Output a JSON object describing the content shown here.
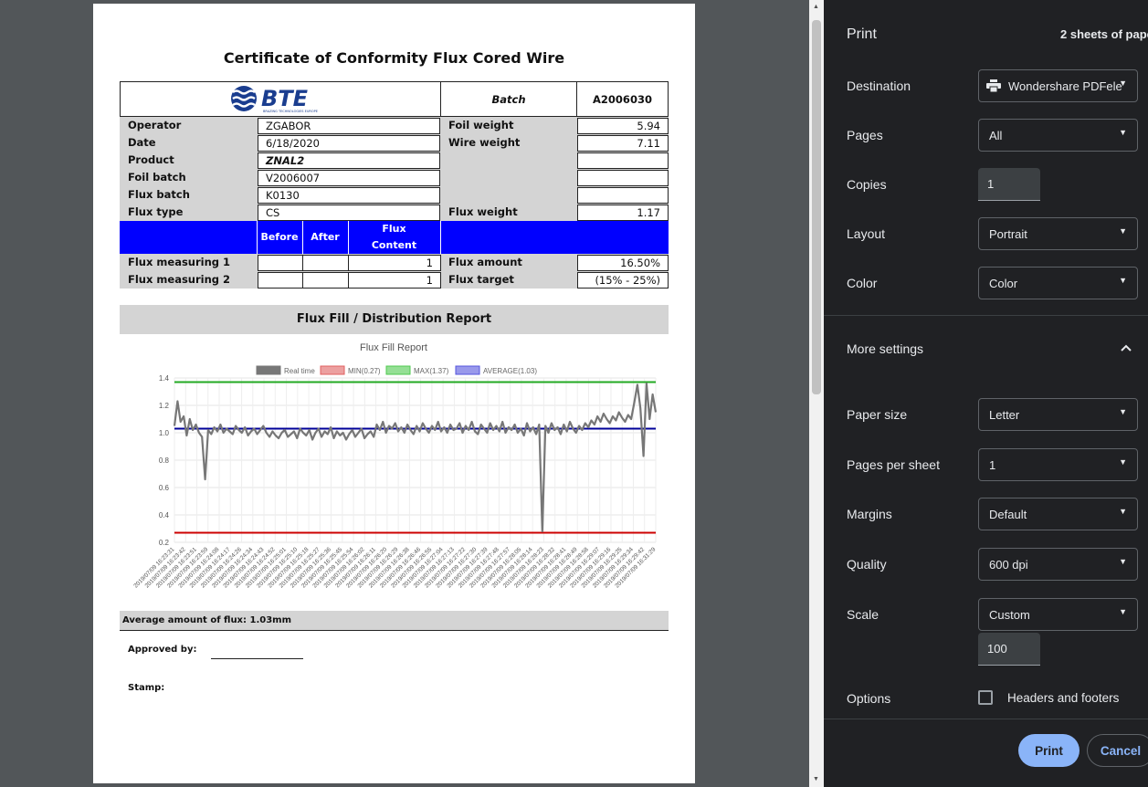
{
  "document": {
    "title": "Certificate of Conformity Flux Cored Wire",
    "logo": {
      "text": "BTE",
      "tagline": "BRAZING TECHNOLOGIES EUROPE",
      "color": "#1a3d8f"
    },
    "batch_label": "Batch",
    "batch_value": "A2006030",
    "left_rows": [
      {
        "label": "Operator",
        "value": "ZGABOR"
      },
      {
        "label": "Date",
        "value": "6/18/2020"
      },
      {
        "label": "Product",
        "value": "ZNAL2"
      },
      {
        "label": "Foil batch",
        "value": "V2006007"
      },
      {
        "label": "Flux batch",
        "value": "K0130"
      },
      {
        "label": "Flux type",
        "value": "CS"
      }
    ],
    "right_rows": [
      {
        "label": "Foil weight",
        "value": "5.94"
      },
      {
        "label": "Wire weight",
        "value": "7.11"
      },
      {
        "label": "",
        "value": ""
      },
      {
        "label": "",
        "value": ""
      },
      {
        "label": "",
        "value": ""
      },
      {
        "label": "Flux weight",
        "value": "1.17"
      }
    ],
    "measure_header": {
      "before": "Before",
      "after": "After",
      "content_line1": "Flux",
      "content_line2": "Content",
      "color": "#0000ff"
    },
    "measure_rows": [
      {
        "label": "Flux measuring 1",
        "before": "",
        "after": "",
        "content": "1",
        "right_label": "Flux amount",
        "right_value": "16.50%"
      },
      {
        "label": "Flux measuring 2",
        "before": "",
        "after": "",
        "content": "1",
        "right_label": "Flux target",
        "right_value": "(15% - 25%)"
      }
    ],
    "report_title": "Flux Fill / Distribution Report",
    "average_text": "Average amount of flux: 1.03mm",
    "approved_label": "Approved by:",
    "stamp_label": "Stamp:"
  },
  "chart_data": {
    "type": "line",
    "title": "Flux Fill Report",
    "legend": [
      {
        "name": "Real time",
        "color": "#777777"
      },
      {
        "name": "MIN(0.27)",
        "color": "#e06060"
      },
      {
        "name": "MAX(1.37)",
        "color": "#4fc94f"
      },
      {
        "name": "AVERAGE(1.03)",
        "color": "#5555dd"
      }
    ],
    "legend_position": "top",
    "ylim": [
      0.2,
      1.4
    ],
    "yticks": [
      "1.4",
      "1.2",
      "1.0",
      "0.8",
      "0.6",
      "0.4",
      "0.2"
    ],
    "grid": true,
    "reference_lines": [
      {
        "name": "MIN(0.27)",
        "value": 0.27,
        "color": "#cc0000"
      },
      {
        "name": "MAX(1.37)",
        "value": 1.37,
        "color": "#22aa22"
      },
      {
        "name": "AVERAGE(1.03)",
        "value": 1.03,
        "color": "#000099"
      }
    ],
    "series_values": [
      1.05,
      1.23,
      1.08,
      1.12,
      0.98,
      1.1,
      1.02,
      1.06,
      1.0,
      0.97,
      0.66,
      1.02,
      0.99,
      1.04,
      1.01,
      1.06,
      1.0,
      1.03,
      1.01,
      0.99,
      1.05,
      1.02,
      1.0,
      1.04,
      0.98,
      1.01,
      1.03,
      0.99,
      1.02,
      1.05,
      1.0,
      0.97,
      1.01,
      0.98,
      0.96,
      1.0,
      1.02,
      0.97,
      0.99,
      1.01,
      0.96,
      1.03,
      1.0,
      0.98,
      1.02,
      0.95,
      1.0,
      1.03,
      0.97,
      1.01,
      0.99,
      1.04,
      0.96,
      1.01,
      0.98,
      1.0,
      0.95,
      0.99,
      1.02,
      0.97,
      1.0,
      1.03,
      0.96,
      0.99,
      1.01,
      0.97,
      1.06,
      1.02,
      1.08,
      1.0,
      1.05,
      1.03,
      1.07,
      1.01,
      1.04,
      1.0,
      1.06,
      1.02,
      0.99,
      1.05,
      1.01,
      1.07,
      1.03,
      1.0,
      1.05,
      1.02,
      1.08,
      1.01,
      1.04,
      1.0,
      1.06,
      1.02,
      1.03,
      1.07,
      1.0,
      1.05,
      1.02,
      1.08,
      1.01,
      0.99,
      1.06,
      1.03,
      1.0,
      1.07,
      1.02,
      1.05,
      1.01,
      1.08,
      1.0,
      1.04,
      1.02,
      1.06,
      1.0,
      1.03,
      0.98,
      1.07,
      1.01,
      1.04,
      0.99,
      1.06,
      0.28,
      1.05,
      1.0,
      1.07,
      1.02,
      1.04,
      0.99,
      1.06,
      1.01,
      1.08,
      1.03,
      1.0,
      1.05,
      1.02,
      1.07,
      1.04,
      1.09,
      1.06,
      1.12,
      1.08,
      1.14,
      1.1,
      1.07,
      1.12,
      1.09,
      1.15,
      1.11,
      1.08,
      1.13,
      1.1,
      1.22,
      1.35,
      1.18,
      0.83,
      1.36,
      1.1,
      1.28,
      1.15
    ],
    "x_labels": [
      "2019/07/09 16:23:31",
      "2019/07/09 16:23:42",
      "2019/07/09 16:23:51",
      "2019/07/09 16:23:59",
      "2019/07/09 16:24:08",
      "2019/07/09 16:24:17",
      "2019/07/09 16:24:26",
      "2019/07/09 16:24:34",
      "2019/07/09 16:24:43",
      "2019/07/09 16:24:52",
      "2019/07/09 16:25:01",
      "2019/07/09 16:25:10",
      "2019/07/09 16:25:18",
      "2019/07/09 16:25:27",
      "2019/07/09 16:25:36",
      "2019/07/09 16:25:45",
      "2019/07/09 16:25:54",
      "2019/07/09 16:26:02",
      "2019/07/09 16:26:11",
      "2019/07/09 16:26:20",
      "2019/07/09 16:26:29",
      "2019/07/09 16:26:38",
      "2019/07/09 16:26:46",
      "2019/07/09 16:26:55",
      "2019/07/09 16:27:04",
      "2019/07/09 16:27:13",
      "2019/07/09 16:27:22",
      "2019/07/09 16:27:30",
      "2019/07/09 16:27:39",
      "2019/07/09 16:27:48",
      "2019/07/09 16:27:57",
      "2019/07/09 16:28:05",
      "2019/07/09 16:28:14",
      "2019/07/09 16:28:23",
      "2019/07/09 16:28:32",
      "2019/07/09 16:28:41",
      "2019/07/09 16:28:49",
      "2019/07/09 16:28:58",
      "2019/07/09 16:29:07",
      "2019/07/09 16:29:16",
      "2019/07/09 16:29:25",
      "2019/07/09 16:29:34",
      "2019/07/09 16:29:42",
      "2019/07/09 16:31:29"
    ]
  },
  "print_panel": {
    "title": "Print",
    "sheets": "2 sheets of pape",
    "destination": {
      "label": "Destination",
      "value": "Wondershare PDFele"
    },
    "pages": {
      "label": "Pages",
      "value": "All"
    },
    "copies": {
      "label": "Copies",
      "value": "1"
    },
    "layout": {
      "label": "Layout",
      "value": "Portrait"
    },
    "color": {
      "label": "Color",
      "value": "Color"
    },
    "more_settings": "More settings",
    "paper_size": {
      "label": "Paper size",
      "value": "Letter"
    },
    "pages_per_sheet": {
      "label": "Pages per sheet",
      "value": "1"
    },
    "margins": {
      "label": "Margins",
      "value": "Default"
    },
    "quality": {
      "label": "Quality",
      "value": "600 dpi"
    },
    "scale": {
      "label": "Scale",
      "value": "Custom",
      "custom_value": "100"
    },
    "options": {
      "label": "Options",
      "headers_footers": "Headers and footers"
    },
    "print_button": "Print",
    "cancel_button": "Cancel",
    "accent": "#8ab4f8"
  }
}
